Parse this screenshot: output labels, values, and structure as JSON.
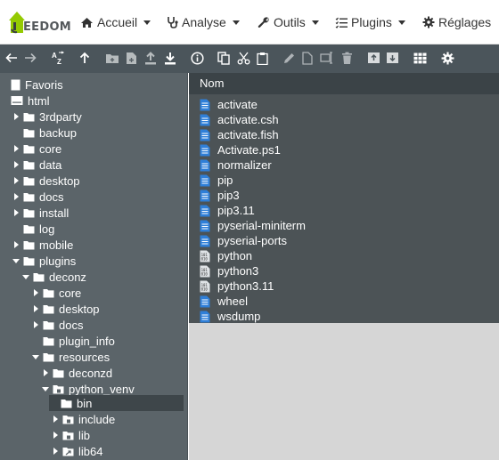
{
  "brand": {
    "logo_text": "EEDOM",
    "logo_mark_letter": "J"
  },
  "nav": [
    {
      "label": "Accueil",
      "icon": "home-icon"
    },
    {
      "label": "Analyse",
      "icon": "stethoscope-icon"
    },
    {
      "label": "Outils",
      "icon": "wrench-icon"
    },
    {
      "label": "Plugins",
      "icon": "tasks-icon"
    },
    {
      "label": "Réglages",
      "icon": "gear-icon"
    }
  ],
  "toolbar": [
    "back-icon",
    "forward-icon",
    "sort-az-icon",
    "parent-dir-icon",
    "new-folder-icon",
    "new-file-icon",
    "upload-icon",
    "download-icon",
    "info-icon",
    "copy-icon",
    "cut-icon",
    "paste-icon",
    "rename-icon",
    "duplicate-icon",
    "edit-icon",
    "delete-icon",
    "archive-icon",
    "extract-icon",
    "view-grid-icon",
    "settings-icon"
  ],
  "tree": {
    "favorites_label": "Favoris",
    "items": [
      {
        "label": "html",
        "type": "root"
      },
      {
        "label": "3rdparty"
      },
      {
        "label": "backup"
      },
      {
        "label": "core"
      },
      {
        "label": "data"
      },
      {
        "label": "desktop"
      },
      {
        "label": "docs"
      },
      {
        "label": "install"
      },
      {
        "label": "log"
      },
      {
        "label": "mobile"
      },
      {
        "label": "plugins"
      },
      {
        "label": "deconz"
      },
      {
        "label": "core"
      },
      {
        "label": "desktop"
      },
      {
        "label": "docs"
      },
      {
        "label": "plugin_info"
      },
      {
        "label": "resources"
      },
      {
        "label": "deconzd"
      },
      {
        "label": "python_venv"
      },
      {
        "label": "bin"
      },
      {
        "label": "include"
      },
      {
        "label": "lib"
      },
      {
        "label": "lib64"
      }
    ]
  },
  "list": {
    "header_name": "Nom",
    "files": [
      {
        "name": "activate",
        "icon": "text-file-icon"
      },
      {
        "name": "activate.csh",
        "icon": "text-file-icon"
      },
      {
        "name": "activate.fish",
        "icon": "text-file-icon"
      },
      {
        "name": "Activate.ps1",
        "icon": "text-file-icon"
      },
      {
        "name": "normalizer",
        "icon": "text-file-icon"
      },
      {
        "name": "pip",
        "icon": "text-file-icon"
      },
      {
        "name": "pip3",
        "icon": "text-file-icon"
      },
      {
        "name": "pip3.11",
        "icon": "text-file-icon"
      },
      {
        "name": "pyserial-miniterm",
        "icon": "text-file-icon"
      },
      {
        "name": "pyserial-ports",
        "icon": "text-file-icon"
      },
      {
        "name": "python",
        "icon": "binary-file-icon"
      },
      {
        "name": "python3",
        "icon": "binary-file-icon"
      },
      {
        "name": "python3.11",
        "icon": "binary-file-icon"
      },
      {
        "name": "wheel",
        "icon": "text-file-icon"
      },
      {
        "name": "wsdump",
        "icon": "text-file-icon"
      }
    ]
  },
  "colors": {
    "brand_green": "#94ca02",
    "toolbar_bg": "#4b555b",
    "tree_bg": "#5b6469",
    "list_header_bg": "#3b4347",
    "list_bg": "#4c5356",
    "file_icon_blue": "#2f7fd8"
  }
}
